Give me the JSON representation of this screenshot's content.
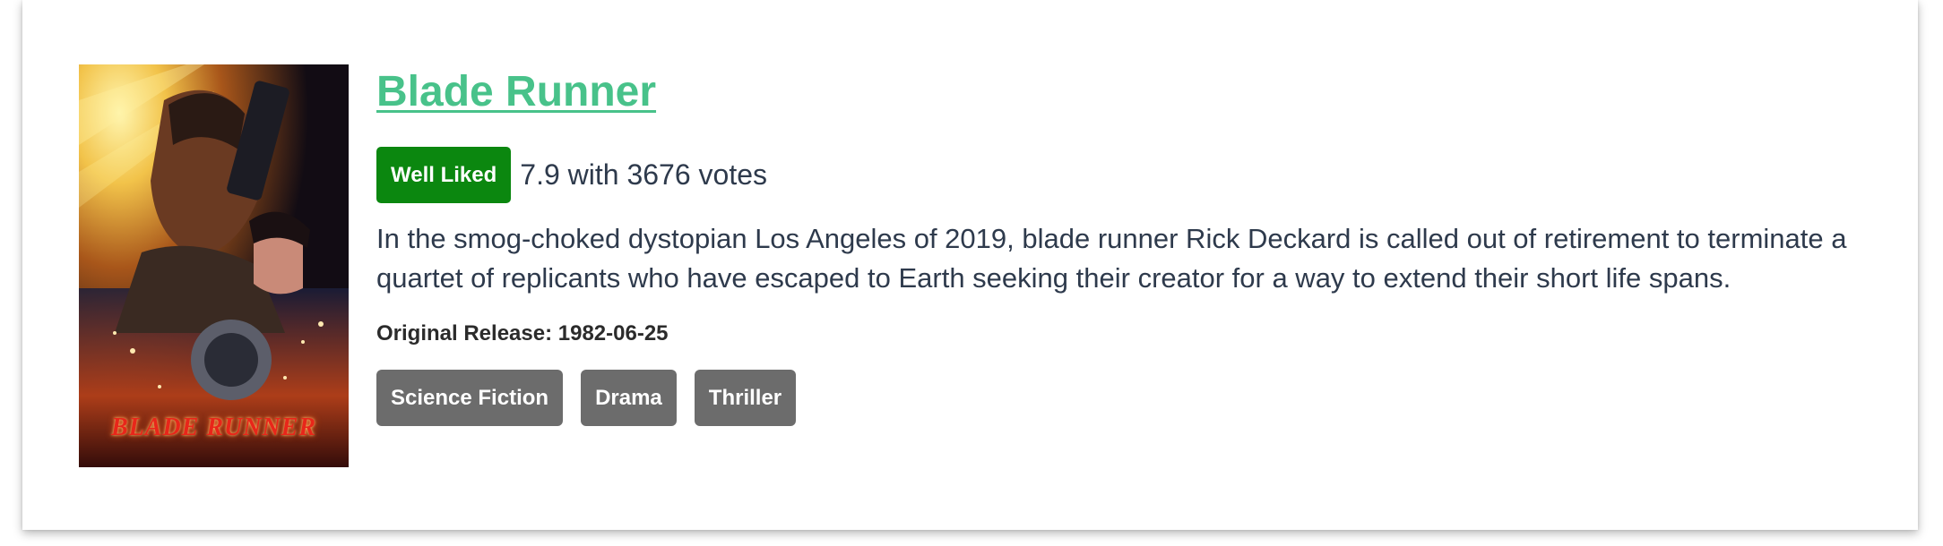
{
  "movie": {
    "title": "Blade Runner",
    "rating_badge": "Well Liked",
    "rating_text": "7.9 with 3676 votes",
    "overview": "In the smog-choked dystopian Los Angeles of 2019, blade runner Rick Deckard is called out of retirement to terminate a quartet of replicants who have escaped to Earth seeking their creator for a way to extend their short life spans.",
    "release": "Original Release: 1982-06-25",
    "genres": [
      "Science Fiction",
      "Drama",
      "Thriller"
    ],
    "poster_text": "BLADE RUNNER"
  },
  "colors": {
    "title": "#48c28a",
    "badge": "#0b870f",
    "genre": "#6c6c6c"
  }
}
